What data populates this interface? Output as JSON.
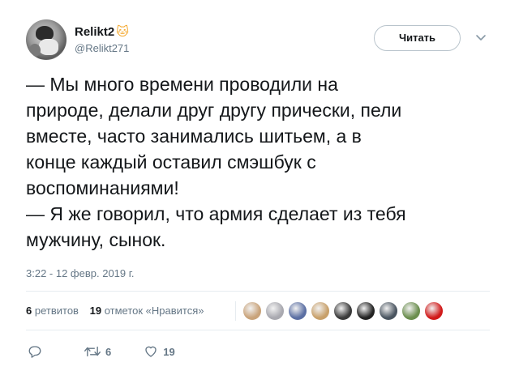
{
  "tweet": {
    "user_name": "Relikt2",
    "name_emoji": "🐱",
    "user_handle": "@Relikt271",
    "follow_label": "Читать",
    "text": "— Мы много времени проводили на\nприроде, делали друг другу прически, пели\nвместе, часто занимались шитьем, а в\nконце каждый оставил смэшбук с\nвоспоминаниями!\n— Я же говорил, что армия сделает из тебя\nмужчину, сынок.",
    "timestamp": "3:22 - 12 февр. 2019 г."
  },
  "stats": {
    "retweets_count": "6",
    "retweets_label": "ретвитов",
    "likes_count": "19",
    "likes_label": "отметок «Нравится»"
  },
  "likers": [
    {
      "name": "liker-avatar-1",
      "color": "#c9a37a"
    },
    {
      "name": "liker-avatar-2",
      "color": "#a9a9b0"
    },
    {
      "name": "liker-avatar-3",
      "color": "#5b6fa3"
    },
    {
      "name": "liker-avatar-4",
      "color": "#c8a06a"
    },
    {
      "name": "liker-avatar-5",
      "color": "#3a3a3a"
    },
    {
      "name": "liker-avatar-6",
      "color": "#222222"
    },
    {
      "name": "liker-avatar-7",
      "color": "#4a5560"
    },
    {
      "name": "liker-avatar-8",
      "color": "#6b8e4e"
    },
    {
      "name": "liker-avatar-9",
      "color": "#d11a1a"
    }
  ],
  "actions": {
    "reply_icon": "reply-icon",
    "retweet_icon": "retweet-icon",
    "retweet_count": "6",
    "like_icon": "heart-icon",
    "like_count": "19"
  },
  "colors": {
    "secondary_text": "#657786",
    "divider": "#e6ecf0",
    "primary_text": "#14171a"
  }
}
